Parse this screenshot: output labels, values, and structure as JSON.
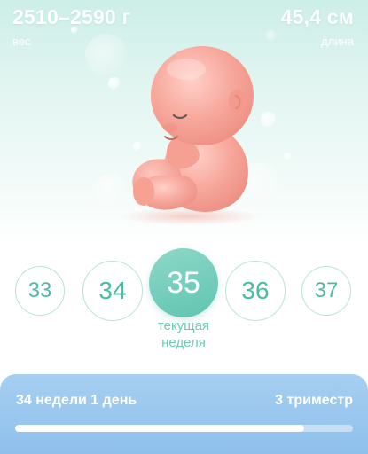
{
  "header": {
    "weight": {
      "value": "2510–2590 г",
      "label": "вес"
    },
    "length": {
      "value": "45,4 см",
      "label": "длина"
    }
  },
  "illustration": {
    "icon": "fetus-illustration"
  },
  "weeks": {
    "items": [
      "33",
      "34",
      "35",
      "36",
      "37"
    ],
    "current": "35",
    "current_label": "текущая неделя"
  },
  "progress": {
    "elapsed": "34 недели 1 день",
    "trimester": "3 триместр",
    "fraction": 0.855
  },
  "colors": {
    "accent": "#5fc4b0",
    "week_text": "#49bba7",
    "progress_card": "#9cc8ee"
  }
}
